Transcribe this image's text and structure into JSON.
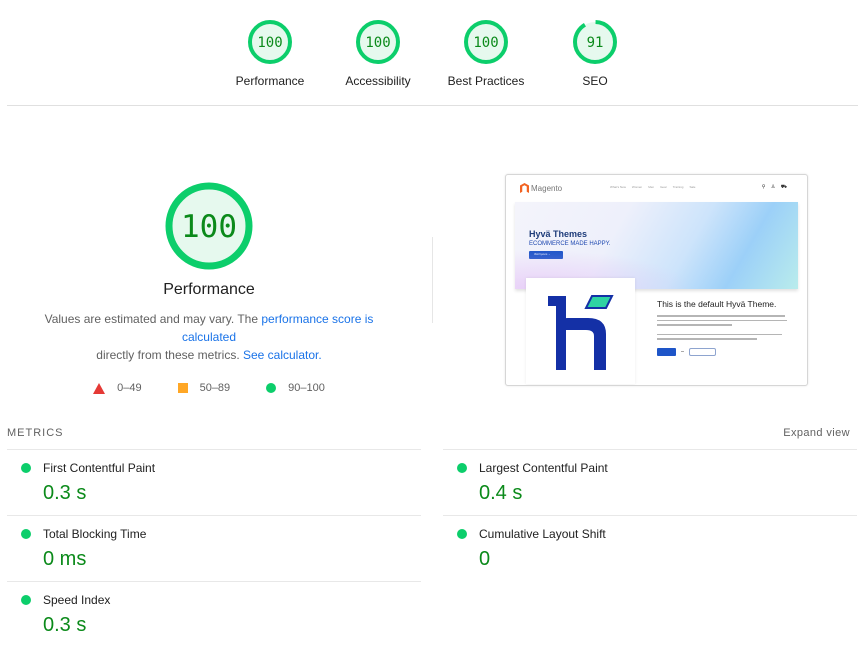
{
  "categories": [
    {
      "label": "Performance",
      "score": 100
    },
    {
      "label": "Accessibility",
      "score": 100
    },
    {
      "label": "Best Practices",
      "score": 100
    },
    {
      "label": "SEO",
      "score": 91
    }
  ],
  "performance": {
    "score": 100,
    "title": "Performance",
    "desc_prefix": "Values are estimated and may vary. The ",
    "link_score": "performance score is calculated",
    "desc_middle": " directly from these metrics. ",
    "link_calculator": "See calculator."
  },
  "legend": [
    {
      "shape": "triangle",
      "range": "0–49",
      "color": "#e53935"
    },
    {
      "shape": "square",
      "range": "50–89",
      "color": "#ffa726"
    },
    {
      "shape": "circle",
      "range": "90–100",
      "color": "#0cce6b"
    }
  ],
  "screenshot": {
    "brand": "Magento",
    "nav_links": [
      "What's New",
      "Women",
      "Men",
      "Gear",
      "Training",
      "Sale"
    ],
    "nav_icons": "⚲ ♙ ⛟",
    "hero_title": "Hyvä Themes",
    "hero_subtitle": "ECOMMERCE MADE HAPPY.",
    "hero_button": "Visit hyva.io →",
    "content_title": "This is the default Hyvä Theme."
  },
  "metrics": {
    "header": "METRICS",
    "expand_label": "Expand view",
    "items": [
      {
        "title": "First Contentful Paint",
        "value": "0.3 s",
        "status": "pass"
      },
      {
        "title": "Largest Contentful Paint",
        "value": "0.4 s",
        "status": "pass"
      },
      {
        "title": "Total Blocking Time",
        "value": "0 ms",
        "status": "pass"
      },
      {
        "title": "Cumulative Layout Shift",
        "value": "0",
        "status": "pass"
      },
      {
        "title": "Speed Index",
        "value": "0.3 s",
        "status": "pass"
      }
    ]
  },
  "colors": {
    "pass": "#0cce6b",
    "pass_text": "#0b8a1a",
    "pass_bg": "#e6f9ee",
    "link": "#1a73e8"
  }
}
